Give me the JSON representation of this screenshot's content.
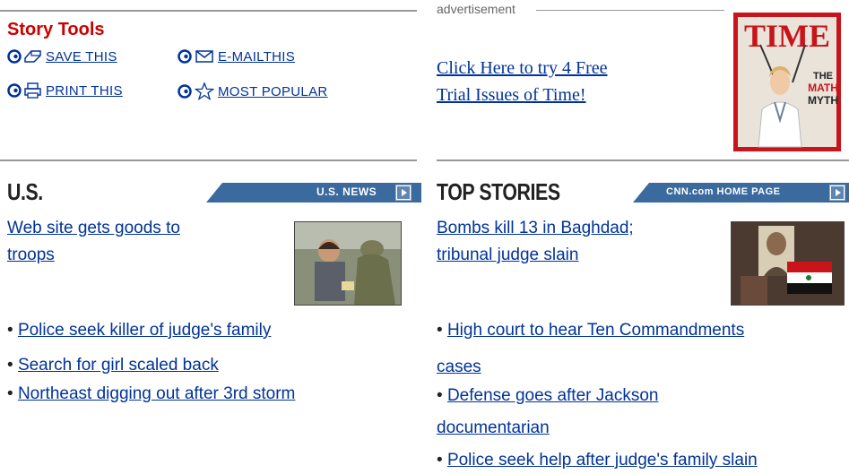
{
  "story_tools": {
    "title": "Story Tools",
    "items": [
      {
        "label": "SAVE THIS",
        "icon": "save-icon"
      },
      {
        "label": "E-MAILTHIS",
        "icon": "email-icon"
      },
      {
        "label": "PRINT THIS",
        "icon": "print-icon"
      },
      {
        "label": "MOST POPULAR",
        "icon": "star-icon"
      }
    ]
  },
  "ad": {
    "label": "advertisement",
    "link_line1": "Click Here to try 4 Free",
    "link_line2": "Trial Issues of Time!",
    "cover": {
      "masthead": "TIME",
      "headline1": "THE",
      "headline2": "MATH",
      "headline3": "MYTH"
    }
  },
  "us": {
    "title": "U.S.",
    "bar_label": "U.S. NEWS",
    "lead_line1": "Web site gets goods to",
    "lead_line2": "troops",
    "bullets": [
      "Police seek killer of judge's family",
      "Search for girl scaled back",
      "Northeast digging out after 3rd storm"
    ]
  },
  "top": {
    "title": "TOP STORIES",
    "bar_label": "CNN.com HOME PAGE",
    "lead_line1": "Bombs kill 13 in Baghdad;",
    "lead_line2": "tribunal judge slain",
    "bullets": [
      {
        "line1": "High court to hear Ten Commandments",
        "line2": "cases"
      },
      {
        "line1": "Defense goes after Jackson",
        "line2": "documentarian"
      },
      {
        "line1": "Police seek help after judge's family slain",
        "line2": ""
      }
    ]
  },
  "colors": {
    "tools_title": "#cc0000",
    "link": "#003399",
    "bar": "#3a6a9e",
    "rule": "#999999"
  }
}
